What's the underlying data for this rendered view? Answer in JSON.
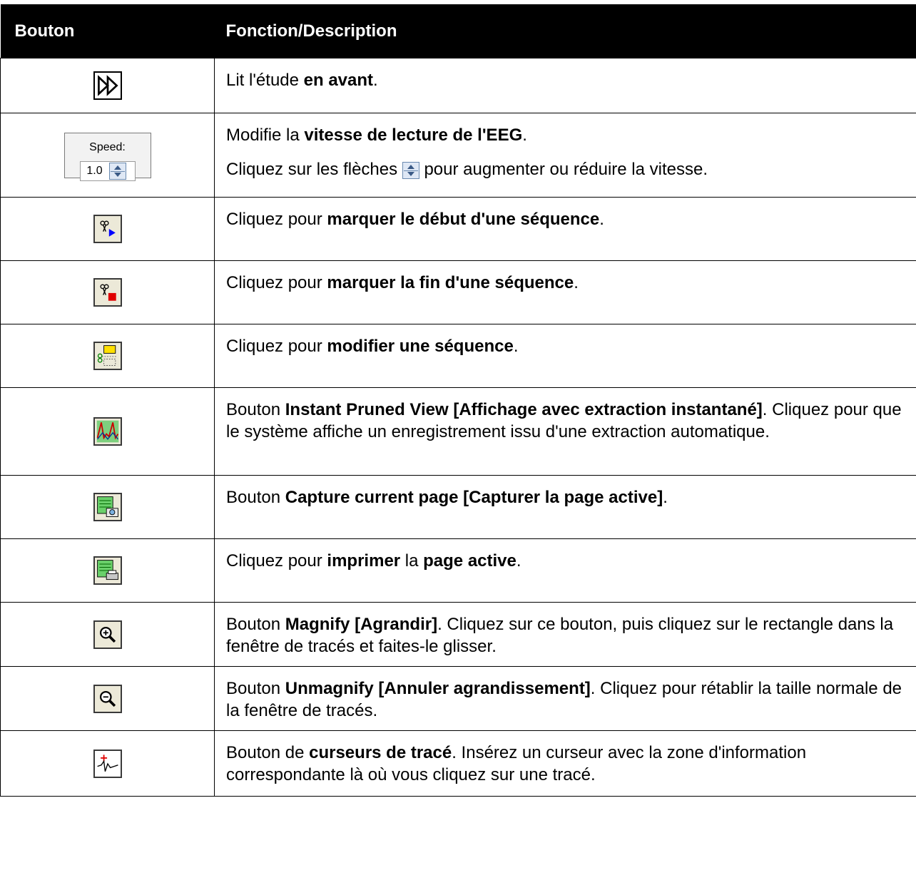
{
  "header": {
    "col_button": "Bouton",
    "col_description": "Fonction/Description"
  },
  "rows": [
    {
      "icon": "play-forward-icon",
      "parts": [
        "Lit l'étude ",
        "en avant",
        "."
      ]
    },
    {
      "icon": "speed-spinner-control",
      "speed_label": "Speed:",
      "speed_value": "1.0",
      "parts": [
        "Modifie la ",
        "vitesse de lecture de l'EEG",
        "."
      ],
      "line2_before": "Cliquez sur les flèches ",
      "line2_after": " pour augmenter ou réduire la vitesse."
    },
    {
      "icon": "mark-sequence-start-icon",
      "parts": [
        "Cliquez pour ",
        "marquer le début d'une séquence",
        "."
      ]
    },
    {
      "icon": "mark-sequence-end-icon",
      "parts": [
        "Cliquez pour ",
        "marquer la fin d'une séquence",
        "."
      ]
    },
    {
      "icon": "edit-sequence-icon",
      "parts": [
        "Cliquez pour ",
        "modifier une séquence",
        "."
      ]
    },
    {
      "icon": "instant-pruned-view-icon",
      "parts": [
        "Bouton ",
        "Instant Pruned View [Affichage avec extraction instantané]",
        ". Cliquez pour que le système affiche un enregistrement issu d'une extraction automatique."
      ]
    },
    {
      "icon": "capture-page-icon",
      "parts": [
        "Bouton ",
        "Capture current page [Capturer la page active]",
        "."
      ]
    },
    {
      "icon": "print-page-icon",
      "parts": [
        "Cliquez pour ",
        "imprimer",
        " la ",
        "page active",
        "."
      ]
    },
    {
      "icon": "magnify-icon",
      "parts": [
        "Bouton ",
        "Magnify [Agrandir]",
        ". Cliquez sur ce bouton, puis cliquez sur le rectangle dans la fenêtre de tracés et faites-le glisser."
      ]
    },
    {
      "icon": "unmagnify-icon",
      "parts": [
        "Bouton ",
        "Unmagnify [Annuler agrandissement]",
        ". Cliquez pour rétablir la taille normale de la fenêtre de tracés."
      ]
    },
    {
      "icon": "trace-cursor-icon",
      "parts": [
        "Bouton de ",
        "curseurs de tracé",
        ". Insérez un curseur avec la zone d'information correspondante là où vous cliquez sur une tracé."
      ]
    }
  ]
}
